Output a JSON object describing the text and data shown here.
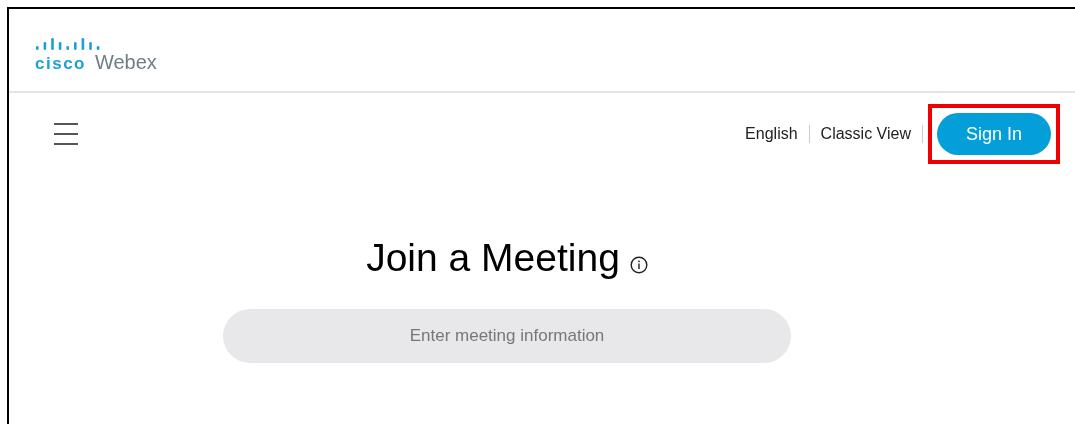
{
  "logo": {
    "brand": "cisco",
    "product": "Webex"
  },
  "nav": {
    "links": [
      {
        "label": "English"
      },
      {
        "label": "Classic View"
      }
    ],
    "sign_in": {
      "label": "Sign In",
      "highlighted": true
    }
  },
  "main": {
    "title": "Join a Meeting",
    "search": {
      "placeholder": "Enter meeting information"
    }
  }
}
